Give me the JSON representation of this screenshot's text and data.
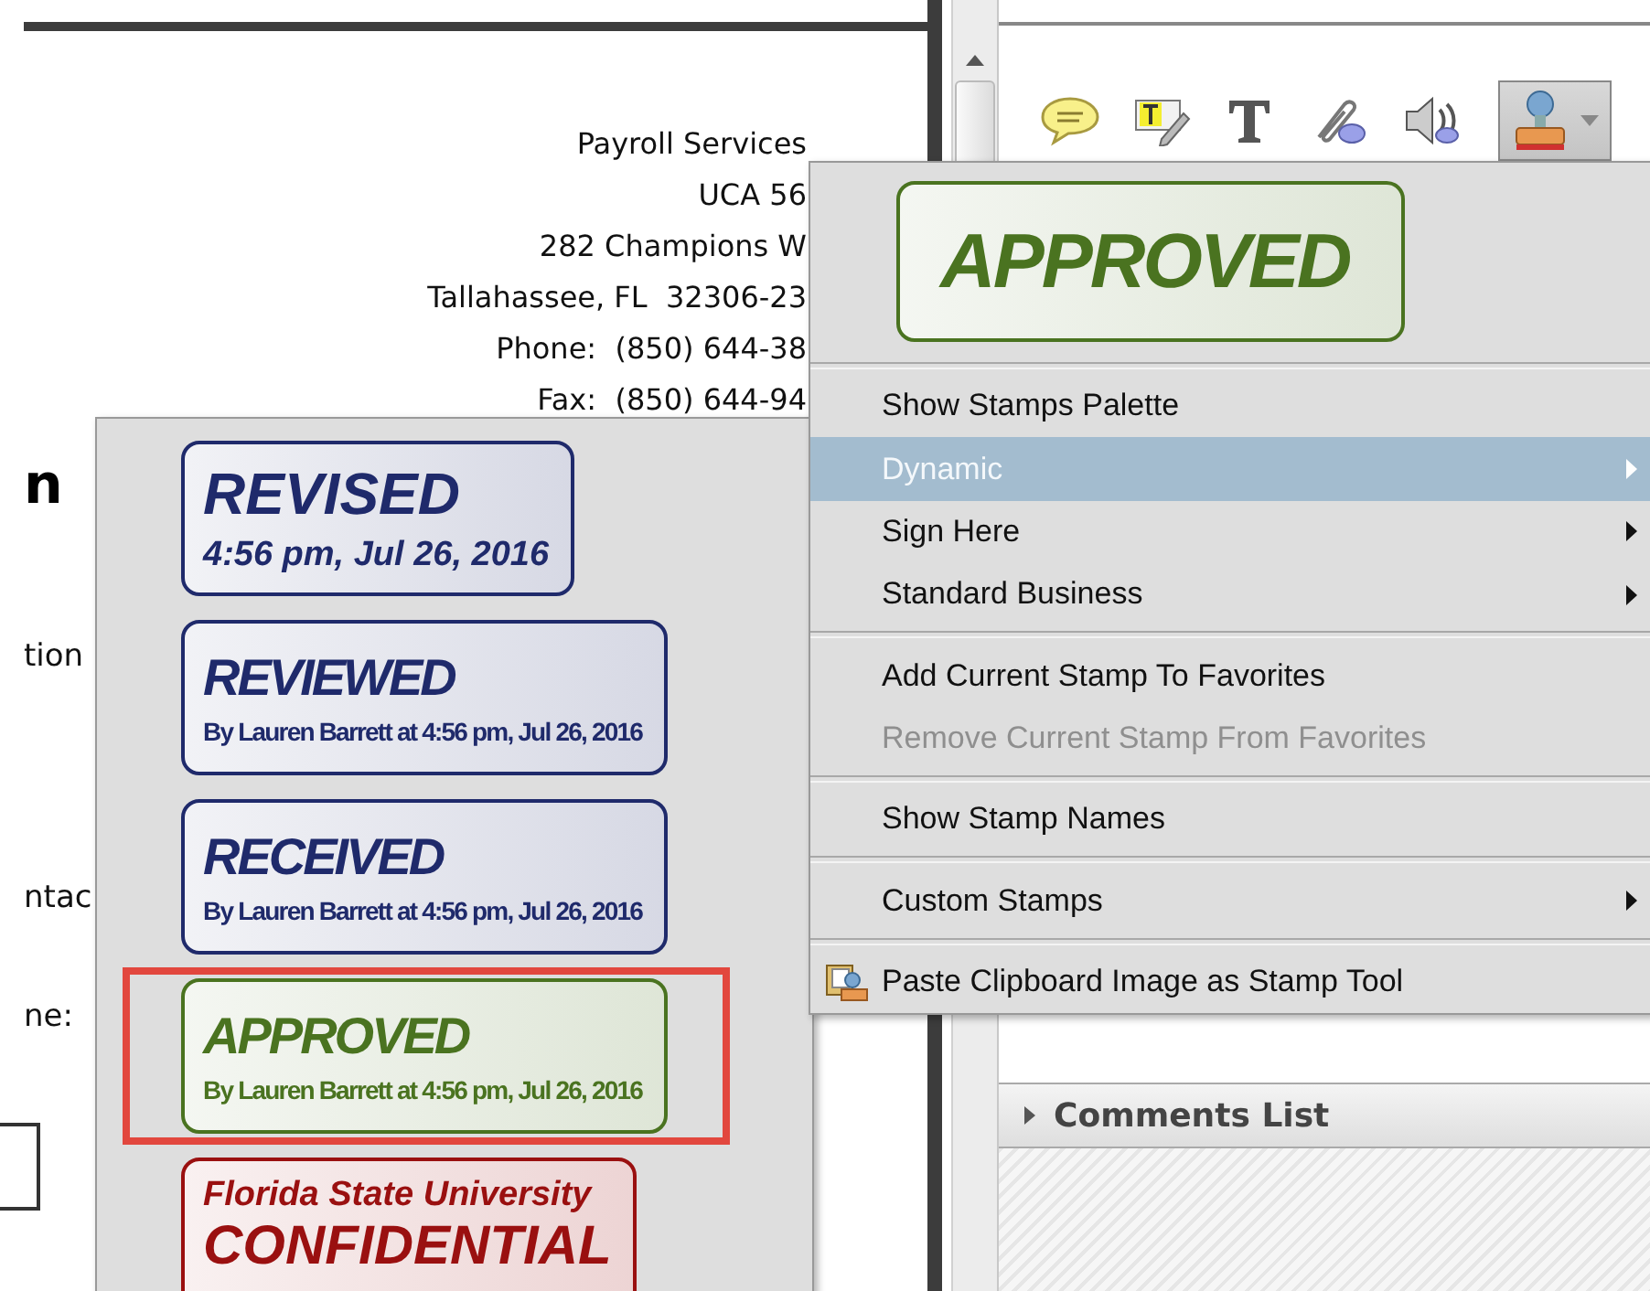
{
  "document": {
    "address": [
      "Payroll Services",
      "UCA 56",
      "282 Champions W",
      "Tallahassee, FL  32306-23",
      "Phone:  (850) 644-38",
      "Fax:  (850) 644-94"
    ],
    "heading": "n",
    "labels": [
      "tion",
      "ntac",
      "ne:"
    ]
  },
  "comments_panel": {
    "section": "Comments List"
  },
  "stamp_menu": {
    "preview": {
      "title": "APPROVED",
      "color": "#4a7320"
    },
    "items": [
      {
        "kind": "separator"
      },
      {
        "kind": "item",
        "label": "Show Stamps Palette",
        "submenu": false,
        "highlighted": false,
        "disabled": false
      },
      {
        "kind": "item",
        "label": "Dynamic",
        "submenu": true,
        "highlighted": true,
        "disabled": false
      },
      {
        "kind": "item",
        "label": "Sign Here",
        "submenu": true,
        "highlighted": false,
        "disabled": false
      },
      {
        "kind": "item",
        "label": "Standard Business",
        "submenu": true,
        "highlighted": false,
        "disabled": false
      },
      {
        "kind": "separator"
      },
      {
        "kind": "item",
        "label": "Add Current Stamp To Favorites",
        "submenu": false,
        "highlighted": false,
        "disabled": false
      },
      {
        "kind": "item",
        "label": "Remove Current Stamp From Favorites",
        "submenu": false,
        "highlighted": false,
        "disabled": true
      },
      {
        "kind": "separator"
      },
      {
        "kind": "item",
        "label": "Show Stamp Names",
        "submenu": false,
        "highlighted": false,
        "disabled": false
      },
      {
        "kind": "separator"
      },
      {
        "kind": "item",
        "label": "Custom Stamps",
        "submenu": true,
        "highlighted": false,
        "disabled": false
      },
      {
        "kind": "separator"
      },
      {
        "kind": "icon-item",
        "label": "Paste Clipboard Image as Stamp Tool",
        "submenu": false,
        "highlighted": false,
        "disabled": false
      }
    ]
  },
  "dynamic_stamps": [
    {
      "kind": "title-first",
      "title": "REVISED",
      "caption": "4:56 pm, Jul 26, 2016",
      "color": "#1f2a6b",
      "selected": false
    },
    {
      "kind": "title-first-condensed",
      "title": "REVIEWED",
      "caption": "By Lauren Barrett at 4:56 pm, Jul 26, 2016",
      "color": "#1f2a6b",
      "selected": false
    },
    {
      "kind": "title-first-condensed",
      "title": "RECEIVED",
      "caption": "By Lauren Barrett at 4:56 pm, Jul 26, 2016",
      "color": "#1f2a6b",
      "selected": false
    },
    {
      "kind": "title-first-condensed",
      "title": "APPROVED",
      "caption": "By Lauren Barrett at 4:56 pm, Jul 26, 2016",
      "color": "#4a7320",
      "selected": true
    },
    {
      "kind": "caption-first",
      "title": "CONFIDENTIAL",
      "caption": "Florida State University",
      "color": "#9a1010",
      "selected": false
    }
  ]
}
